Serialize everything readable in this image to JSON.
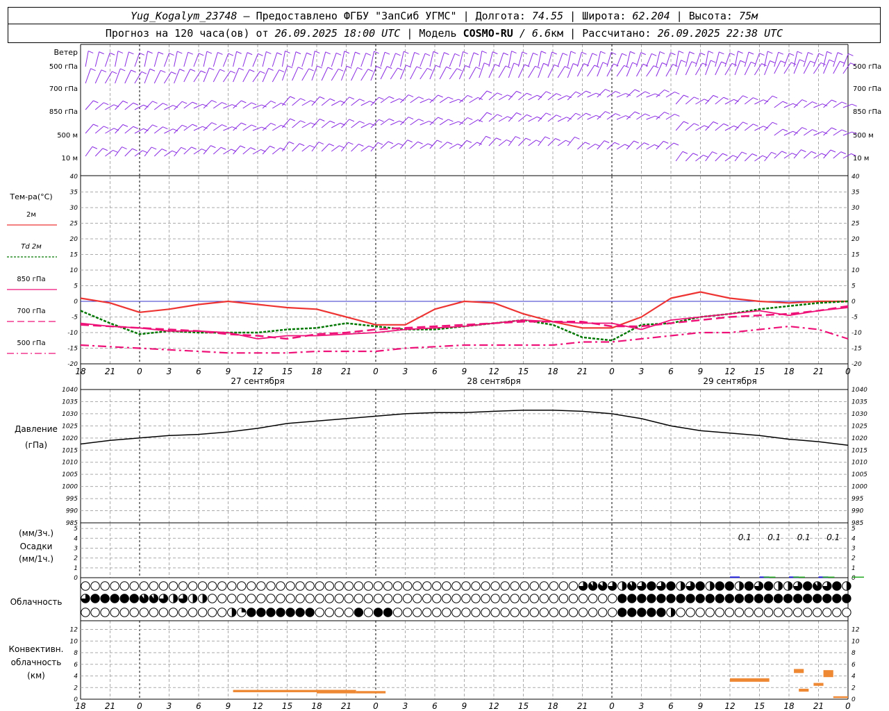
{
  "header": {
    "station": "Yug_Kogalym_23748",
    "dash": "—",
    "provider": "Предоставлено ФГБУ \"ЗапСиб УГМС\"",
    "sep": "|",
    "lon_label": "Долгота:",
    "lon_value": "74.55",
    "lat_label": "Широта:",
    "lat_value": "62.204",
    "alt_label": "Высота:",
    "alt_value": "75м",
    "forecast_label": "Прогноз на 120 часа(ов) от",
    "forecast_from": "26.09.2025 18:00 UTC",
    "model_label": "Модель",
    "model_name": "COSMO-RU",
    "model_res": "/ 6.6",
    "model_unit": "км",
    "calc_label": "Рассчитано:",
    "calc_time": "26.09.2025 22:38 UTC"
  },
  "colors": {
    "wind": "#8a2be2",
    "t2m": "#ee3333",
    "td2m": "#007700",
    "t850": "#ee1177",
    "t700": "#ee1177",
    "t500": "#ee1177",
    "zero_line": "#3333cc",
    "precip_3h": "#2222dd",
    "precip_1h": "#22aa22",
    "conv": "#ee8833"
  },
  "x_axis": {
    "hour_labels": [
      "18",
      "21",
      "0",
      "3",
      "6",
      "9",
      "12",
      "15",
      "18",
      "21",
      "0",
      "3",
      "6",
      "9",
      "12",
      "15",
      "18",
      "21",
      "0",
      "3",
      "6",
      "9",
      "12",
      "15",
      "18",
      "21",
      "0"
    ],
    "day_labels": [
      "27 сентября",
      "28 сентября",
      "29 сентября"
    ]
  },
  "wind_panel": {
    "title": "Ветер",
    "levels": [
      "500 гПа",
      "700 гПа",
      "850 гПа",
      "500 м",
      "10 м"
    ]
  },
  "temp_panel": {
    "title": "Тем-ра(°С)",
    "legend": [
      {
        "key": "t2m",
        "label": "2м"
      },
      {
        "key": "td2m",
        "label": "Td 2м"
      },
      {
        "key": "t850",
        "label": "850 гПа"
      },
      {
        "key": "t700",
        "label": "700 гПа"
      },
      {
        "key": "t500",
        "label": "500 гПа"
      }
    ],
    "yticks": [
      "40",
      "35",
      "30",
      "25",
      "20",
      "15",
      "10",
      "5",
      "0",
      "-5",
      "-10",
      "-15",
      "-20"
    ]
  },
  "pressure_panel": {
    "title": "Давление",
    "unit": "(гПа)",
    "yticks": [
      "1040",
      "1035",
      "1030",
      "1025",
      "1020",
      "1015",
      "1010",
      "1005",
      "1000",
      "995",
      "990",
      "985"
    ]
  },
  "precip_panel": {
    "unit_3h": "(мм/3ч.)",
    "title": "Осадки",
    "unit_1h": "(мм/1ч.)",
    "yticks": [
      "5",
      "4",
      "3",
      "2",
      "1",
      "0"
    ],
    "labels": [
      "0.1",
      "0.1",
      "0.1",
      "0.1"
    ]
  },
  "cloud_panel": {
    "title": "Облачность"
  },
  "conv_panel": {
    "title1": "Конвективн.",
    "title2": "облачность",
    "unit": "(км)",
    "yticks": [
      "12",
      "10",
      "8",
      "6",
      "4",
      "2",
      "0"
    ]
  },
  "chart_data": [
    {
      "type": "line",
      "title": "Тем-ра(°С)",
      "x": [
        0,
        3,
        6,
        9,
        12,
        15,
        18,
        21,
        24,
        27,
        30,
        33,
        36,
        39,
        42,
        45,
        48,
        51,
        54,
        57,
        60,
        63,
        66,
        69,
        72,
        75,
        78
      ],
      "x_hour_labels": [
        "18",
        "21",
        "0",
        "3",
        "6",
        "9",
        "12",
        "15",
        "18",
        "21",
        "0",
        "3",
        "6",
        "9",
        "12",
        "15",
        "18",
        "21",
        "0",
        "3",
        "6",
        "9",
        "12",
        "15",
        "18",
        "21",
        "0"
      ],
      "ylim": [
        -20,
        40
      ],
      "series": [
        {
          "name": "2м",
          "values": [
            1.0,
            -0.5,
            -3.5,
            -2.5,
            -1,
            0,
            -1,
            -2,
            -2.5,
            -5,
            -7.5,
            -7.5,
            -2.5,
            0,
            -0.5,
            -4,
            -6.5,
            -8.5,
            -8.5,
            -5,
            1,
            3,
            1,
            0,
            -0.5,
            0,
            0
          ]
        },
        {
          "name": "Td 2м",
          "values": [
            -3,
            -7,
            -10.5,
            -9.5,
            -10,
            -10,
            -10,
            -9,
            -8.5,
            -7,
            -8,
            -9,
            -9,
            -8,
            -7,
            -6,
            -7.5,
            -11.5,
            -12.5,
            -7.5,
            -7,
            -5,
            -4,
            -2.5,
            -1.5,
            -0.5,
            0
          ]
        },
        {
          "name": "850 гПа",
          "values": [
            -7,
            -8,
            -8.5,
            -9.5,
            -9.5,
            -10,
            -12,
            -11,
            -11,
            -10.5,
            -10,
            -9,
            -8.5,
            -8,
            -7,
            -6,
            -6.5,
            -7,
            -7,
            -9,
            -6,
            -5,
            -4,
            -3,
            -4.5,
            -3,
            -2
          ]
        },
        {
          "name": "700 гПа",
          "values": [
            -7.5,
            -8,
            -8.5,
            -9,
            -9.5,
            -10.5,
            -11,
            -12,
            -10.5,
            -10,
            -9,
            -8.5,
            -8,
            -7.5,
            -7,
            -6.5,
            -6.5,
            -6.5,
            -8,
            -8,
            -7,
            -6,
            -5,
            -4.5,
            -4,
            -3,
            -1.5
          ]
        },
        {
          "name": "500 гПа",
          "values": [
            -14,
            -14.5,
            -15,
            -15.5,
            -16,
            -16.5,
            -16.5,
            -16.5,
            -16,
            -16,
            -16,
            -15,
            -14.5,
            -14,
            -14,
            -14,
            -14,
            -13,
            -13,
            -12,
            -11,
            -10,
            -10,
            -9,
            -8,
            -9,
            -12
          ]
        }
      ]
    },
    {
      "type": "line",
      "title": "Давление",
      "x": [
        0,
        3,
        6,
        9,
        12,
        15,
        18,
        21,
        24,
        27,
        30,
        33,
        36,
        39,
        42,
        45,
        48,
        51,
        54,
        57,
        60,
        63,
        66,
        69,
        72,
        75,
        78
      ],
      "ylim": [
        985,
        1040
      ],
      "series": [
        {
          "name": "Давление",
          "values": [
            1017.5,
            1019,
            1020,
            1021,
            1021.5,
            1022.5,
            1024,
            1026,
            1027,
            1028,
            1029,
            1030,
            1030.5,
            1030.5,
            1031,
            1031.5,
            1031.5,
            1031,
            1030,
            1028,
            1025,
            1023,
            1022,
            1021,
            1019.5,
            1018.5,
            1017
          ]
        }
      ]
    },
    {
      "type": "bar",
      "title": "Осадки",
      "x": [
        0,
        3,
        6,
        9,
        12,
        15,
        18,
        21,
        24,
        27,
        30,
        33,
        36,
        39,
        42,
        45,
        48,
        51,
        54,
        57,
        60,
        63,
        66,
        69,
        72,
        75,
        78
      ],
      "ylim": [
        0,
        5
      ],
      "series": [
        {
          "name": "мм/3ч",
          "values": [
            0,
            0,
            0,
            0,
            0,
            0,
            0,
            0,
            0,
            0,
            0,
            0,
            0,
            0,
            0,
            0,
            0,
            0,
            0,
            0,
            0,
            0,
            0.1,
            0.1,
            0.1,
            0.1,
            0
          ]
        },
        {
          "name": "мм/1ч",
          "values": [
            0,
            0,
            0,
            0,
            0,
            0,
            0,
            0,
            0,
            0,
            0,
            0,
            0,
            0,
            0,
            0,
            0,
            0,
            0,
            0,
            0,
            0,
            0,
            0.05,
            0.05,
            0.05,
            0.05
          ]
        }
      ]
    },
    {
      "type": "bar",
      "title": "Конвективн. облачность (км)",
      "ylim": [
        0,
        13
      ],
      "segments": [
        {
          "x0": 15.5,
          "x1": 27,
          "base": 1.2,
          "top": 1.6
        },
        {
          "x0": 24,
          "x1": 28,
          "base": 1.0,
          "top": 1.6
        },
        {
          "x0": 28,
          "x1": 31,
          "base": 1.0,
          "top": 1.4
        },
        {
          "x0": 66,
          "x1": 70,
          "base": 3.0,
          "top": 3.6
        },
        {
          "x0": 72.5,
          "x1": 73.5,
          "base": 4.5,
          "top": 5.2
        },
        {
          "x0": 73,
          "x1": 74,
          "base": 1.3,
          "top": 1.8
        },
        {
          "x0": 74.5,
          "x1": 75.5,
          "base": 2.3,
          "top": 2.8
        },
        {
          "x0": 75.5,
          "x1": 76.5,
          "base": 3.8,
          "top": 5.0
        },
        {
          "x0": 76.5,
          "x1": 78,
          "base": 0.2,
          "top": 0.5
        }
      ]
    }
  ]
}
